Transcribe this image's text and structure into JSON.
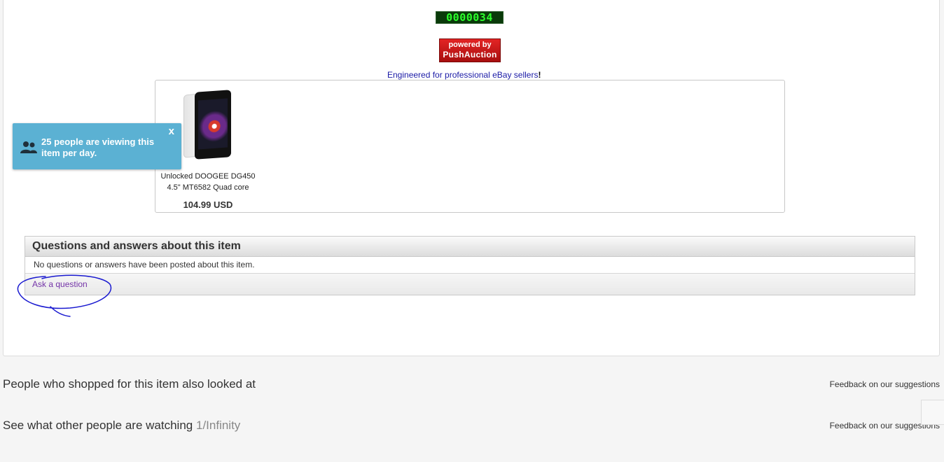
{
  "counter": {
    "value": "0000034"
  },
  "powered_badge": {
    "line1": "powered by",
    "line2": "PushAuction"
  },
  "tagline": {
    "text": "Engineered for professional eBay sellers",
    "bang": "!"
  },
  "item": {
    "title_line1": "Unlocked DOOGEE DG450",
    "title_line2": "4.5\" MT6582 Quad core",
    "price": "104.99 USD"
  },
  "viewers_popup": {
    "text": "25 people are viewing this item per day.",
    "close": "x",
    "icon": "people-icon",
    "color": "#5bb1d3"
  },
  "qa": {
    "heading": "Questions and answers about this item",
    "empty_text": "No questions or answers have been posted about this item.",
    "ask_link": "Ask a question"
  },
  "sections": [
    {
      "title": "People who shopped for this item also looked at",
      "pager": "",
      "feedback": "Feedback on our suggestions"
    },
    {
      "title": "See what other people are watching",
      "pager": "1/Infinity",
      "feedback": "Feedback on our suggestions"
    }
  ],
  "colors": {
    "link_visited": "#7434a8",
    "tagline": "#1a1aa6",
    "annotation": "#1a1ad0"
  }
}
